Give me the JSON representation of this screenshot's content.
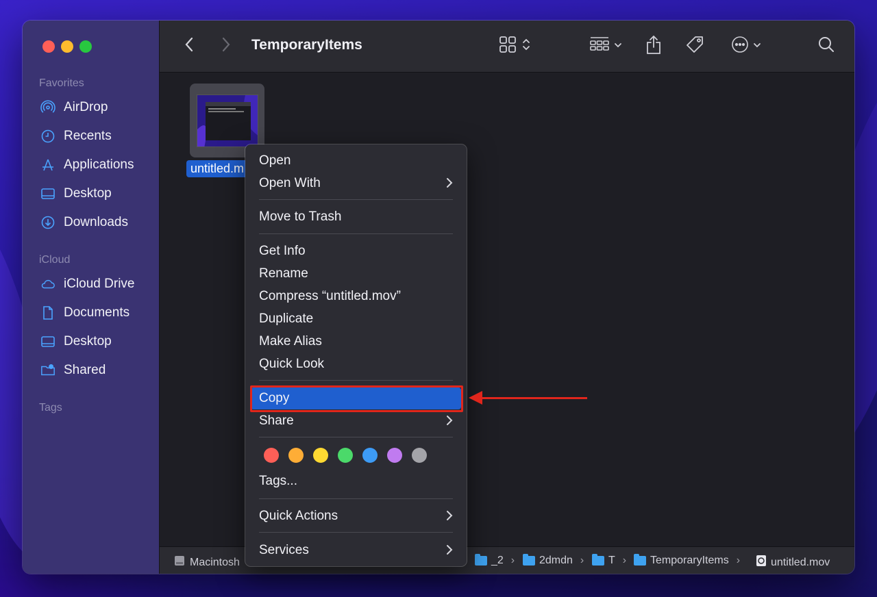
{
  "window": {
    "title": "TemporaryItems"
  },
  "colors": {
    "accent": "#1f5fcf",
    "highlight_red": "#e0261c",
    "sidebar_icon": "#4aa3ff",
    "traffic": [
      "#ff5f57",
      "#febc2e",
      "#28c840"
    ],
    "tag_colors": [
      "#fe5f57",
      "#fead36",
      "#fed932",
      "#4bd96a",
      "#3d9bf5",
      "#c07bf0",
      "#a4a4a9"
    ]
  },
  "sidebar": {
    "favorites_header": "Favorites",
    "icloud_header": "iCloud",
    "tags_header": "Tags",
    "favorites": [
      {
        "label": "AirDrop",
        "icon": "airdrop-icon"
      },
      {
        "label": "Recents",
        "icon": "clock-icon"
      },
      {
        "label": "Applications",
        "icon": "applications-icon"
      },
      {
        "label": "Desktop",
        "icon": "desktop-icon"
      },
      {
        "label": "Downloads",
        "icon": "download-icon"
      }
    ],
    "icloud": [
      {
        "label": "iCloud Drive",
        "icon": "cloud-icon"
      },
      {
        "label": "Documents",
        "icon": "document-icon"
      },
      {
        "label": "Desktop",
        "icon": "desktop-icon"
      },
      {
        "label": "Shared",
        "icon": "shared-folder-icon"
      }
    ]
  },
  "file": {
    "label": "untitled.m"
  },
  "context_menu": {
    "open": "Open",
    "open_with": "Open With",
    "move_to_trash": "Move to Trash",
    "get_info": "Get Info",
    "rename": "Rename",
    "compress": "Compress “untitled.mov”",
    "duplicate": "Duplicate",
    "make_alias": "Make Alias",
    "quick_look": "Quick Look",
    "copy": "Copy",
    "share": "Share",
    "tags": "Tags...",
    "quick_actions": "Quick Actions",
    "services": "Services",
    "chevron": "›"
  },
  "pathbar": {
    "disk": "Macintosh",
    "items": [
      "_2",
      "2dmdn",
      "T",
      "TemporaryItems"
    ],
    "file": "untitled.mov",
    "sep": "›"
  }
}
